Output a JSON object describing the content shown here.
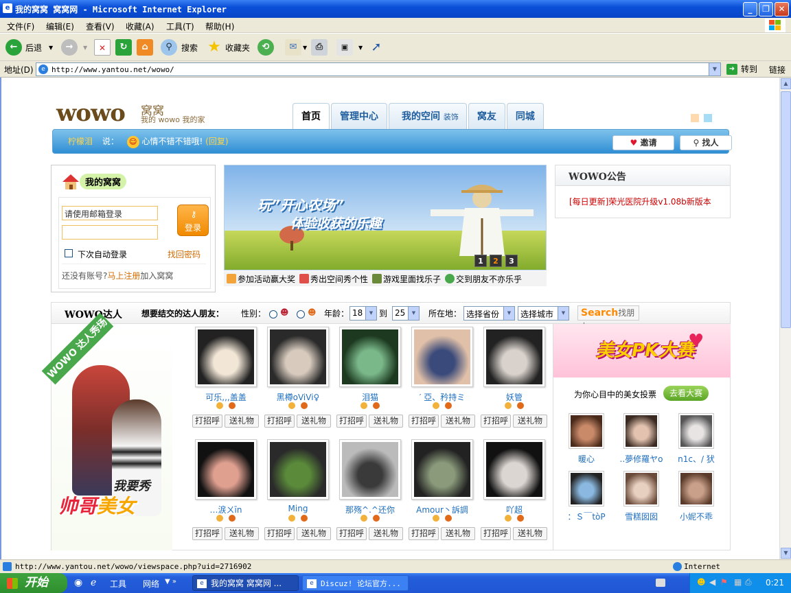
{
  "window": {
    "title": "我的窝窝 窝窝网 - Microsoft Internet Explorer"
  },
  "menu": [
    "文件(F)",
    "编辑(E)",
    "查看(V)",
    "收藏(A)",
    "工具(T)",
    "帮助(H)"
  ],
  "toolbar": {
    "back": "后退",
    "search": "搜索",
    "favorites": "收藏夹"
  },
  "address": {
    "label": "地址(D)",
    "url": "http://www.yantou.net/wowo/",
    "go": "转到",
    "links": "链接"
  },
  "site": {
    "logo_text": "wowo",
    "logo_cn": "窝窝",
    "logo_sub": "我的 wowo 我的家",
    "tabs": [
      {
        "label": "首页",
        "extra": ""
      },
      {
        "label": "管理中心",
        "extra": ""
      },
      {
        "label": "我的空间",
        "extra": "装饰"
      },
      {
        "label": "窝友",
        "extra": ""
      },
      {
        "label": "同城",
        "extra": ""
      }
    ],
    "status_name": "柠檬泪",
    "status_said": "说：",
    "status_msg": "心情不错不错哦!",
    "status_reply": "(回复)",
    "invite": "邀请",
    "find": "找人"
  },
  "login": {
    "title": "我的窝窝",
    "email_placeholder": "请使用邮箱登录",
    "button": "登录",
    "remember": "下次自动登录",
    "forgot": "找回密码",
    "no_account": "还没有账号?",
    "register": "马上注册",
    "join": "加入窝窝"
  },
  "banner": {
    "line1": "玩”开心农场”",
    "line2": "体验收获的乐趣",
    "pages": [
      "1",
      "2",
      "3"
    ],
    "active_page": "2",
    "links": [
      "参加活动赢大奖",
      "秀出空间秀个性",
      "游戏里面找乐子",
      "交到朋友不亦乐乎"
    ]
  },
  "notice": {
    "title": "WOWO公告",
    "item": "[每日更新]荣光医院升级v1.08b新版本"
  },
  "daren": {
    "title": "WOWO达人",
    "question": "想要结交的达人朋友：",
    "gender_label": "性别：",
    "age_label": "年龄：",
    "age_from": "18",
    "to": "到",
    "age_to": "25",
    "location_label": "所在地：",
    "province": "选择省份",
    "city": "选择城市",
    "search_en": "Search",
    "search_cn": "找朋友",
    "show_ribbon": "WOWO 达人秀场",
    "show_line1": "我要秀",
    "show_line2a": "帅哥",
    "show_line2b": "美女",
    "greet": "打招呼",
    "gift": "送礼物",
    "people": [
      {
        "name": "可乐,,,盖盖"
      },
      {
        "name": "黑樽oViVi♀"
      },
      {
        "name": "泪猫"
      },
      {
        "name": "′ 亞、矜持ミ"
      },
      {
        "name": "妖管"
      },
      {
        "name": "…涙ㄨīn"
      },
      {
        "name": "Ming"
      },
      {
        "name": "那殇^.^还你"
      },
      {
        "name": "Amour丶訴調"
      },
      {
        "name": "吖超"
      }
    ]
  },
  "pk": {
    "title": "美女PK大赛",
    "vote_text": "为你心目中的美女投票",
    "go_btn": "去看大赛",
    "girls": [
      {
        "name": "暖心"
      },
      {
        "name": "..夢修羅ヤo"
      },
      {
        "name": "n1c、/ 犾"
      },
      {
        "name": "：Ｓ￣tòP"
      },
      {
        "name": "雪糕囡囡"
      },
      {
        "name": "小妮不乖"
      }
    ]
  },
  "status": {
    "text": "http://www.yantou.net/wowo/viewspace.php?uid=2716902",
    "zone": "Internet"
  },
  "taskbar": {
    "start": "开始",
    "tools": "工具",
    "network": "网络",
    "task1": "我的窝窝 窝窝网 ...",
    "task2": "Discuz! 论坛官方...",
    "clock": "0:21"
  }
}
